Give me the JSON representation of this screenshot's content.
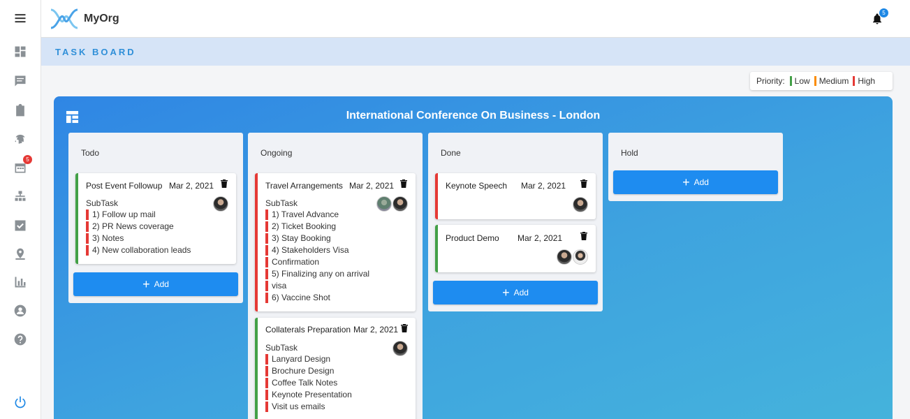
{
  "app": {
    "brand": "MyOrg",
    "notification_count": "5"
  },
  "sidebar": {
    "calendar_badge": "5",
    "items": [
      {
        "icon": "menu-icon"
      },
      {
        "icon": "dashboard-icon"
      },
      {
        "icon": "chat-icon"
      },
      {
        "icon": "clipboard-icon"
      },
      {
        "icon": "fingerprint-icon"
      },
      {
        "icon": "calendar-icon"
      },
      {
        "icon": "org-chart-icon"
      },
      {
        "icon": "checkbox-icon"
      },
      {
        "icon": "location-icon"
      },
      {
        "icon": "bar-chart-icon"
      },
      {
        "icon": "account-icon"
      },
      {
        "icon": "help-icon"
      },
      {
        "icon": "power-icon"
      }
    ]
  },
  "page": {
    "title": "TASK BOARD"
  },
  "legend": {
    "label": "Priority:",
    "low": "Low",
    "medium": "Medium",
    "high": "High",
    "colors": {
      "low": "#43a047",
      "medium": "#fb8c00",
      "high": "#e53935"
    }
  },
  "board": {
    "title": "International Conference On Business - London",
    "add_label": "Add",
    "columns": [
      {
        "title": "Todo",
        "cards": [
          {
            "title": "Post Event Followup",
            "date": "Mar 2, 2021",
            "priority": "low",
            "subtask_label": "SubTask",
            "subtasks": [
              "1) Follow up mail",
              "2) PR News coverage",
              "3) Notes",
              "4) New collaboration leads"
            ]
          }
        ]
      },
      {
        "title": "Ongoing",
        "cards": [
          {
            "title": "Travel Arrangements",
            "date": "Mar 2, 2021",
            "priority": "high",
            "subtask_label": "SubTask",
            "subtasks": [
              "1) Travel Advance",
              "2) Ticket Booking",
              "3) Stay Booking",
              "4) Stakeholders Visa",
              "Confirmation",
              "5) Finalizing any on arrival",
              "visa",
              "6) Vaccine Shot"
            ]
          },
          {
            "title": "Collaterals Preparation",
            "date": "Mar 2, 2021",
            "priority": "low",
            "subtask_label": "SubTask",
            "subtasks": [
              "Lanyard Design",
              "Brochure Design",
              "Coffee Talk Notes",
              "Keynote Presentation",
              "Visit us emails"
            ]
          }
        ]
      },
      {
        "title": "Done",
        "cards": [
          {
            "title": "Keynote Speech",
            "date": "Mar 2, 2021",
            "priority": "high"
          },
          {
            "title": "Product Demo",
            "date": "Mar 2, 2021",
            "priority": "low"
          }
        ]
      },
      {
        "title": "Hold",
        "cards": []
      }
    ]
  }
}
